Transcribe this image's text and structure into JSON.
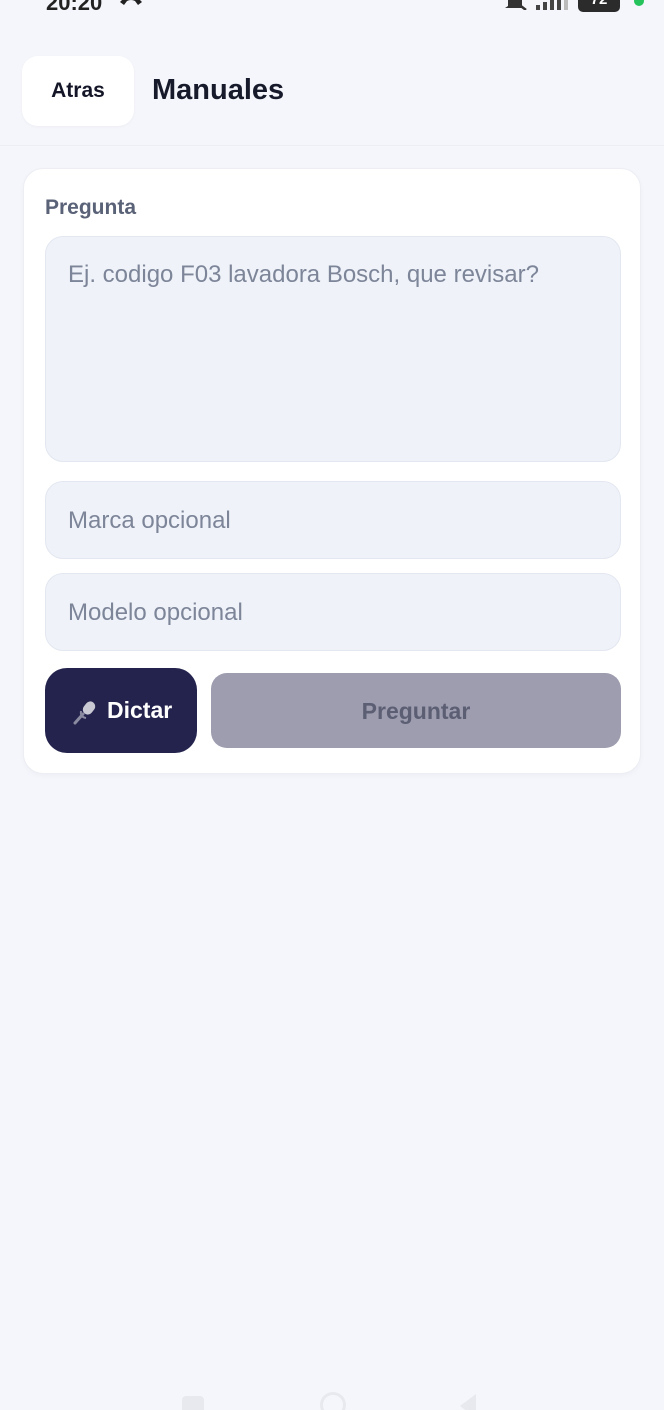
{
  "status_bar": {
    "time": "20:20",
    "notifications": "···",
    "battery": "72",
    "icons": [
      "call-icon",
      "mute-icon",
      "signal-icon",
      "battery-icon"
    ]
  },
  "header": {
    "back_label": "Atras",
    "title": "Manuales"
  },
  "form": {
    "question_label": "Pregunta",
    "question_placeholder": "Ej. codigo F03 lavadora Bosch, que revisar?",
    "question_value": "",
    "brand_placeholder": "Marca opcional",
    "brand_value": "",
    "model_placeholder": "Modelo opcional",
    "model_value": "",
    "dictate_label": "Dictar",
    "dictate_icon": "microphone-icon",
    "ask_label": "Preguntar",
    "ask_enabled": false
  },
  "colors": {
    "background": "#f5f6fb",
    "card": "#ffffff",
    "input": "#eff2f8",
    "dictate_button": "#24234d",
    "ask_button_disabled": "#9d9daf",
    "status_online": "#26c35d"
  }
}
